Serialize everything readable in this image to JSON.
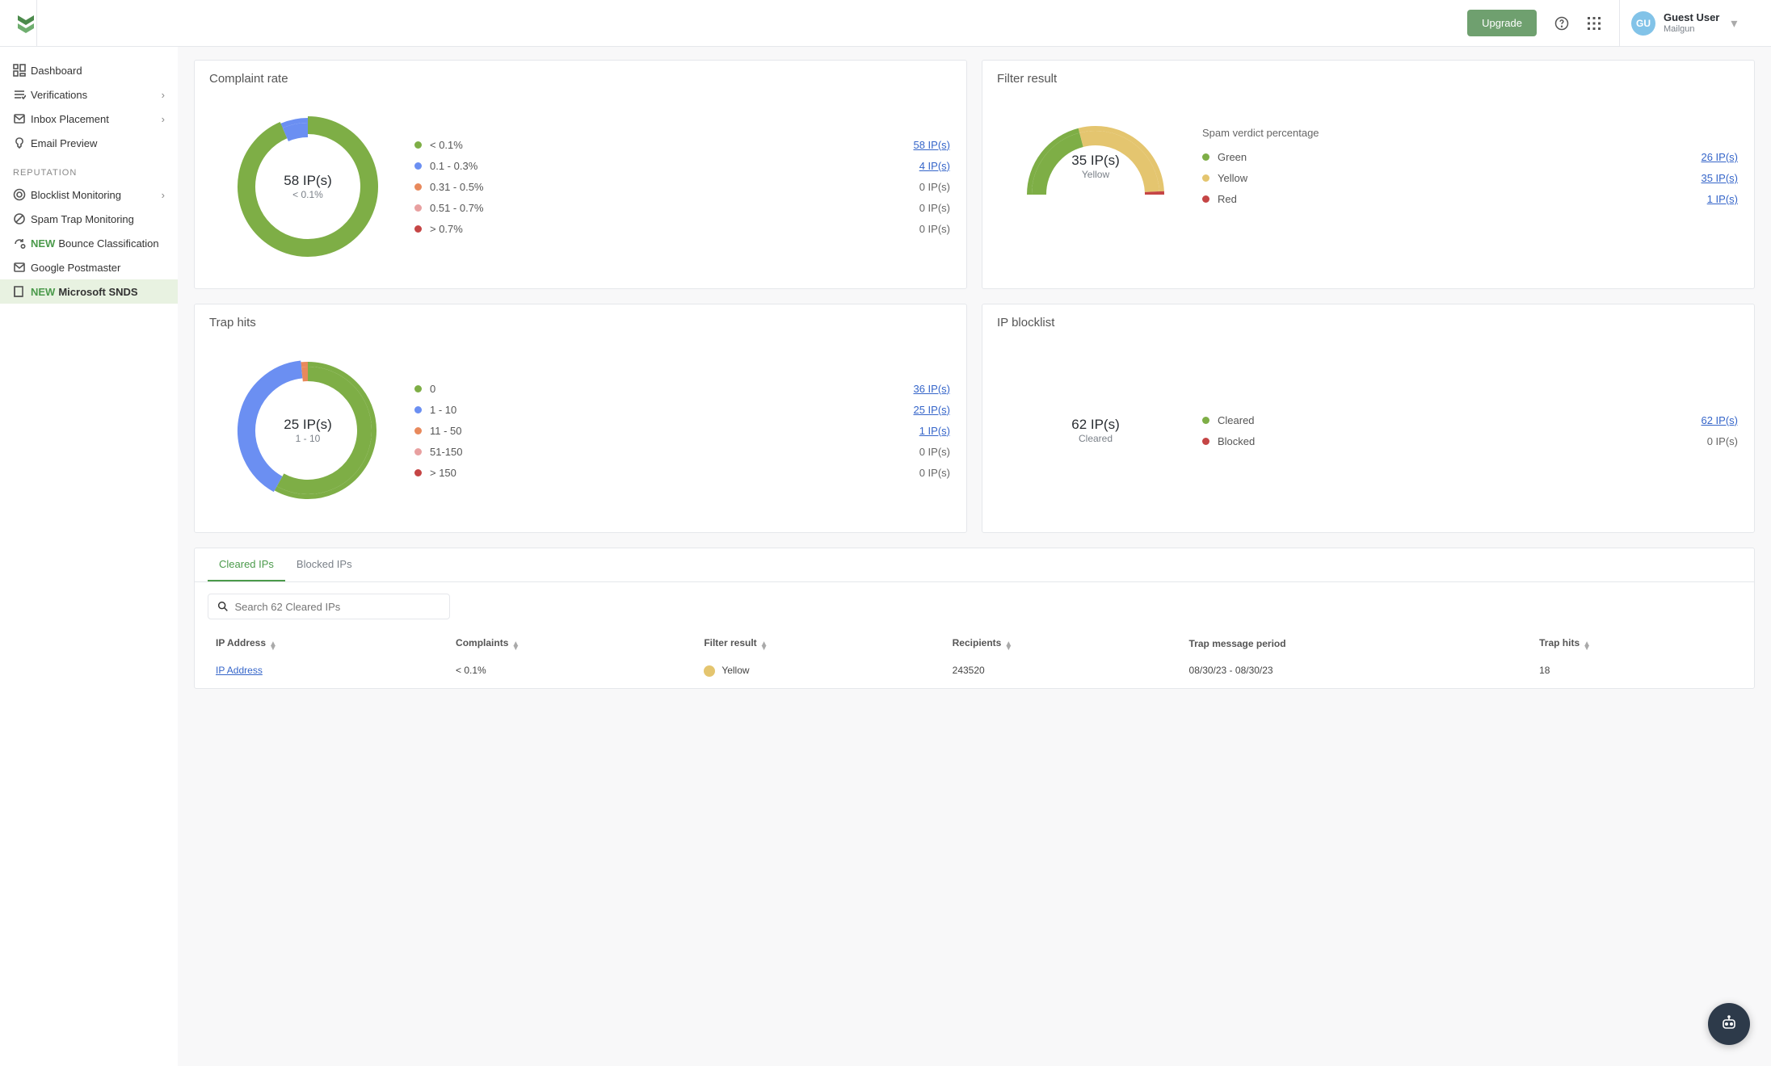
{
  "header": {
    "upgrade": "Upgrade",
    "user": {
      "initials": "GU",
      "name": "Guest User",
      "account": "Mailgun"
    }
  },
  "sidebar": {
    "top": [
      {
        "label": "Dashboard",
        "chev": false
      },
      {
        "label": "Verifications",
        "chev": true
      },
      {
        "label": "Inbox Placement",
        "chev": true
      },
      {
        "label": "Email Preview",
        "chev": false
      }
    ],
    "section": "REPUTATION",
    "rep": [
      {
        "label": "Blocklist Monitoring",
        "chev": true,
        "new": false
      },
      {
        "label": "Spam Trap Monitoring",
        "chev": false,
        "new": false
      },
      {
        "label": "Bounce Classification",
        "chev": false,
        "new": true
      },
      {
        "label": "Google Postmaster",
        "chev": false,
        "new": false
      },
      {
        "label": "Microsoft SNDS",
        "chev": false,
        "new": true,
        "active": true
      }
    ]
  },
  "colors": {
    "green": "#7eae46",
    "blue": "#6b8ff2",
    "orange": "#e8895c",
    "pink": "#e8a0a0",
    "red": "#c54545",
    "yellow": "#e4c56f"
  },
  "cards": {
    "complaint": {
      "title": "Complaint rate",
      "center": {
        "value": "58 IP(s)",
        "sub": "< 0.1%"
      },
      "items": [
        {
          "color": "green",
          "label": "< 0.1%",
          "value": "58 IP(s)",
          "link": true
        },
        {
          "color": "blue",
          "label": "0.1 - 0.3%",
          "value": "4 IP(s)",
          "link": true
        },
        {
          "color": "orange",
          "label": "0.31 - 0.5%",
          "value": "0 IP(s)",
          "link": false
        },
        {
          "color": "pink",
          "label": "0.51 - 0.7%",
          "value": "0 IP(s)",
          "link": false
        },
        {
          "color": "red",
          "label": "> 0.7%",
          "value": "0 IP(s)",
          "link": false
        }
      ]
    },
    "filter": {
      "title": "Filter result",
      "subtitle": "Spam verdict percentage",
      "center": {
        "value": "35 IP(s)",
        "sub": "Yellow"
      },
      "items": [
        {
          "color": "green",
          "label": "Green",
          "value": "26 IP(s)",
          "link": true
        },
        {
          "color": "yellow",
          "label": "Yellow",
          "value": "35 IP(s)",
          "link": true
        },
        {
          "color": "red",
          "label": "Red",
          "value": "1 IP(s)",
          "link": true
        }
      ]
    },
    "trap": {
      "title": "Trap hits",
      "center": {
        "value": "25 IP(s)",
        "sub": "1 - 10"
      },
      "items": [
        {
          "color": "green",
          "label": "0",
          "value": "36 IP(s)",
          "link": true
        },
        {
          "color": "blue",
          "label": "1 - 10",
          "value": "25 IP(s)",
          "link": true
        },
        {
          "color": "orange",
          "label": "11 - 50",
          "value": "1 IP(s)",
          "link": true
        },
        {
          "color": "pink",
          "label": "51-150",
          "value": "0 IP(s)",
          "link": false
        },
        {
          "color": "red",
          "label": "> 150",
          "value": "0 IP(s)",
          "link": false
        }
      ]
    },
    "block": {
      "title": "IP blocklist",
      "center": {
        "value": "62 IP(s)",
        "sub": "Cleared"
      },
      "items": [
        {
          "color": "green",
          "label": "Cleared",
          "value": "62 IP(s)",
          "link": true
        },
        {
          "color": "red",
          "label": "Blocked",
          "value": "0 IP(s)",
          "link": false
        }
      ]
    }
  },
  "tabs": {
    "cleared": "Cleared IPs",
    "blocked": "Blocked IPs"
  },
  "search": {
    "placeholder": "Search 62 Cleared IPs"
  },
  "table": {
    "headers": {
      "ip": "IP Address",
      "complaints": "Complaints",
      "filter": "Filter result",
      "recipients": "Recipients",
      "trapPeriod": "Trap message period",
      "trapHits": "Trap hits"
    },
    "rows": [
      {
        "ip": "IP Address",
        "complaints": "< 0.1%",
        "filter_color": "yellow",
        "filter": "Yellow",
        "recipients": "243520",
        "trapPeriod": "08/30/23 - 08/30/23",
        "trapHits": "18"
      }
    ]
  },
  "chart_data": [
    {
      "type": "pie",
      "title": "Complaint rate",
      "series": [
        {
          "name": "< 0.1%",
          "value": 58
        },
        {
          "name": "0.1 - 0.3%",
          "value": 4
        },
        {
          "name": "0.31 - 0.5%",
          "value": 0
        },
        {
          "name": "0.51 - 0.7%",
          "value": 0
        },
        {
          "name": "> 0.7%",
          "value": 0
        }
      ],
      "highlight_label": "< 0.1%"
    },
    {
      "type": "pie",
      "title": "Filter result — Spam verdict percentage",
      "series": [
        {
          "name": "Green",
          "value": 26
        },
        {
          "name": "Yellow",
          "value": 35
        },
        {
          "name": "Red",
          "value": 1
        }
      ],
      "highlight_label": "Yellow",
      "gauge": true
    },
    {
      "type": "pie",
      "title": "Trap hits",
      "series": [
        {
          "name": "0",
          "value": 36
        },
        {
          "name": "1 - 10",
          "value": 25
        },
        {
          "name": "11 - 50",
          "value": 1
        },
        {
          "name": "51-150",
          "value": 0
        },
        {
          "name": "> 150",
          "value": 0
        }
      ],
      "highlight_label": "1 - 10"
    },
    {
      "type": "pie",
      "title": "IP blocklist",
      "series": [
        {
          "name": "Cleared",
          "value": 62
        },
        {
          "name": "Blocked",
          "value": 0
        }
      ],
      "highlight_label": "Cleared"
    }
  ]
}
